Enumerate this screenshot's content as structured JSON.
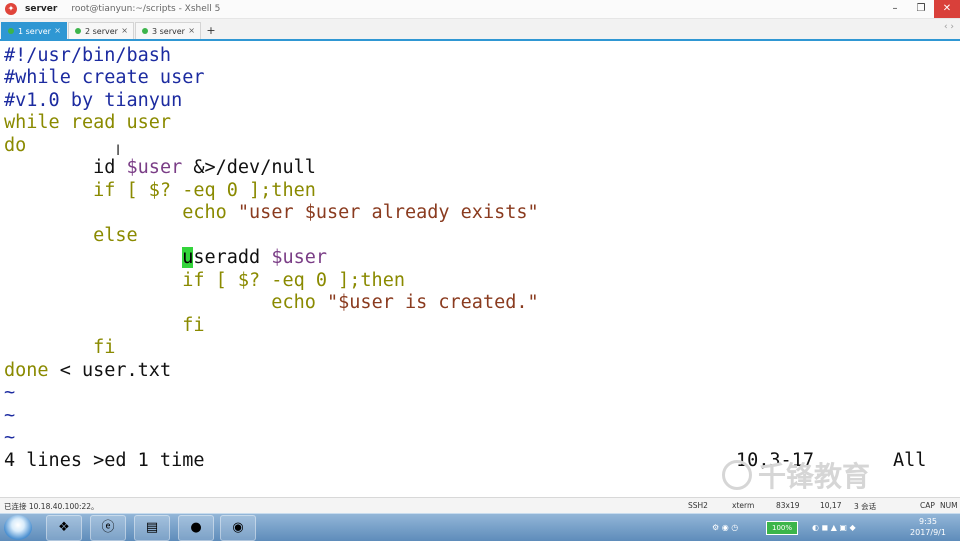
{
  "titlebar": {
    "session": "server",
    "title": "root@tianyun:~/scripts - Xshell 5"
  },
  "tabs": [
    {
      "label": "1 server",
      "active": true
    },
    {
      "label": "2 server",
      "active": false
    },
    {
      "label": "3 server",
      "active": false
    }
  ],
  "tab_add": "+",
  "tab_nav": "‹ ›",
  "terminal": {
    "lines": {
      "l1": "#!/usr/bin/bash",
      "l2": "#while create user",
      "l3": "#v1.0 by tianyun",
      "l4": "while read user",
      "l5": "do",
      "l6a": "        id ",
      "l6b": "$user",
      "l6c": " &>/dev/null",
      "l7a": "        if [ $? -eq 0 ];then",
      "l8a": "                echo ",
      "l8b": "\"user $user already exists\"",
      "l9": "        else",
      "l10a": "                ",
      "l10b": "u",
      "l10c": "seradd ",
      "l10d": "$user",
      "l11": "                if [ $? -eq 0 ];then",
      "l12a": "                        echo ",
      "l12b": "\"$user is created.\"",
      "l13": "                fi",
      "l14": "        fi",
      "l15a": "done",
      "l15b": " < user.txt",
      "t1": "~",
      "t2": "~",
      "t3": "~"
    },
    "status_message": "4 lines >ed 1 time",
    "cursor_position": "10,3-17",
    "scroll_position": "All"
  },
  "statusbar": {
    "connection": "已连接 10.18.40.100:22。",
    "protocol": "SSH2",
    "terminal_type": "xterm",
    "size": "83x19",
    "cursor": "10,17",
    "sessions": "3 会话",
    "caps": "CAP",
    "num": "NUM"
  },
  "watermark": "千锋教育",
  "taskbar": {
    "battery": "100%",
    "time": "9:35",
    "date": "2017/9/1"
  }
}
